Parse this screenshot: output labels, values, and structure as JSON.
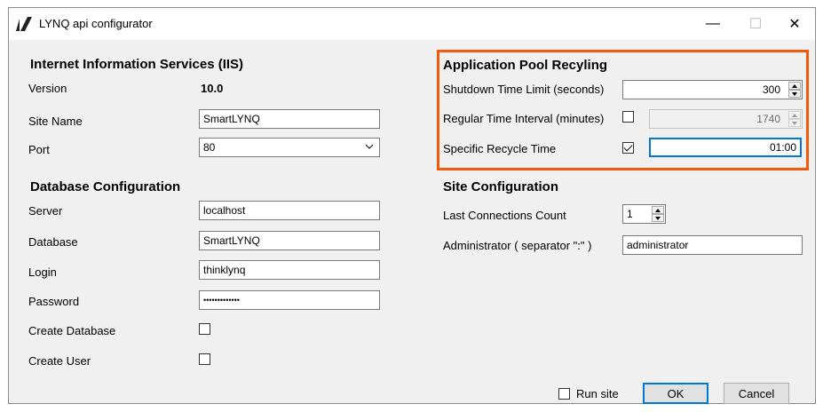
{
  "window": {
    "title": "LYNQ api configurator",
    "controls": {
      "minimize": "—",
      "maximize": "☐",
      "close": "✕"
    }
  },
  "iis": {
    "header": "Internet Information Services (IIS)",
    "version_label": "Version",
    "version_value": "10.0",
    "site_name_label": "Site Name",
    "site_name_value": "SmartLYNQ",
    "port_label": "Port",
    "port_value": "80"
  },
  "database": {
    "header": "Database Configuration",
    "server_label": "Server",
    "server_value": "localhost",
    "database_label": "Database",
    "database_value": "SmartLYNQ",
    "login_label": "Login",
    "login_value": "thinklynq",
    "password_label": "Password",
    "password_value": "•••••••••••••",
    "create_database_label": "Create Database",
    "create_database_checked": false,
    "create_user_label": "Create User",
    "create_user_checked": false
  },
  "app_pool": {
    "header": "Application Pool Recyling",
    "shutdown_label": "Shutdown Time Limit (seconds)",
    "shutdown_value": "300",
    "regular_label": "Regular Time Interval (minutes)",
    "regular_checked": false,
    "regular_value": "1740",
    "specific_label": "Specific Recycle Time",
    "specific_checked": true,
    "specific_value": "01:00",
    "highlight_color": "#f05a0a"
  },
  "site_config": {
    "header": "Site Configuration",
    "last_connections_label": "Last Connections Count",
    "last_connections_value": "1",
    "administrator_label": "Administrator ( separator \":\" )",
    "administrator_value": "administrator"
  },
  "footer": {
    "run_site_label": "Run site",
    "run_site_checked": false,
    "ok_label": "OK",
    "cancel_label": "Cancel"
  },
  "colors": {
    "accent": "#0078d7",
    "window_bg": "#f0f0f0"
  }
}
